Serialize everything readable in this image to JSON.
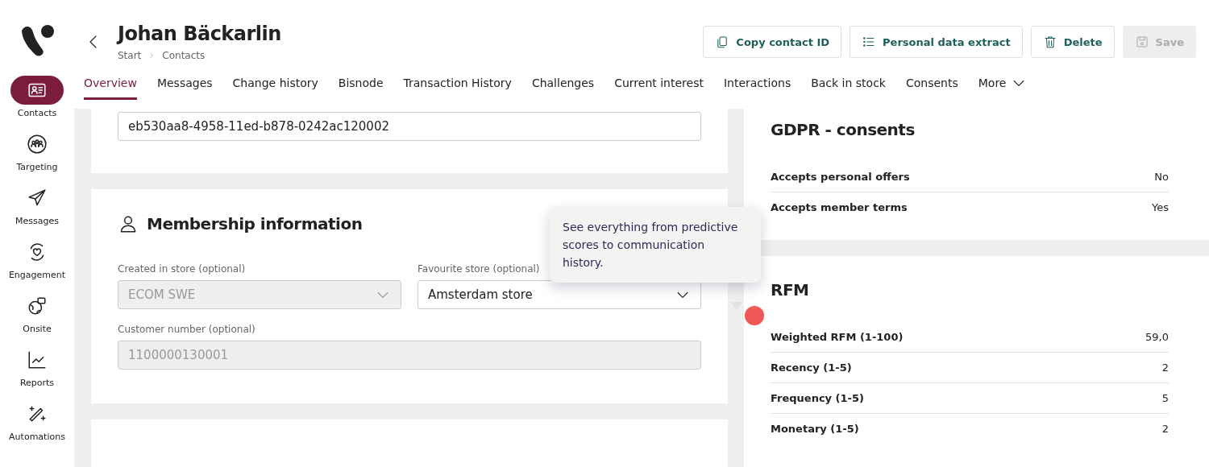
{
  "sidebar": {
    "items": [
      {
        "label": "Contacts",
        "selected": true
      },
      {
        "label": "Targeting",
        "selected": false
      },
      {
        "label": "Messages",
        "selected": false
      },
      {
        "label": "Engagement",
        "selected": false
      },
      {
        "label": "Onsite",
        "selected": false
      },
      {
        "label": "Reports",
        "selected": false
      },
      {
        "label": "Automations",
        "selected": false
      }
    ]
  },
  "header": {
    "title": "Johan Bäckarlin",
    "breadcrumb": [
      "Start",
      "Contacts"
    ],
    "buttons": [
      {
        "label": "Copy contact ID",
        "disabled": false
      },
      {
        "label": "Personal data extract",
        "disabled": false
      },
      {
        "label": "Delete",
        "disabled": false
      },
      {
        "label": "Save",
        "disabled": true
      }
    ]
  },
  "tabs": [
    {
      "label": "Overview",
      "selected": true,
      "kind": "tab"
    },
    {
      "label": "Messages",
      "selected": false,
      "kind": "tab"
    },
    {
      "label": "Change history",
      "selected": false,
      "kind": "tab"
    },
    {
      "label": "Bisnode",
      "selected": false,
      "kind": "tab"
    },
    {
      "label": "Transaction History",
      "selected": false,
      "kind": "tab"
    },
    {
      "label": "Challenges",
      "selected": false,
      "kind": "tab"
    },
    {
      "label": "Current interest",
      "selected": false,
      "kind": "tab"
    },
    {
      "label": "Interactions",
      "selected": false,
      "kind": "tab"
    },
    {
      "label": "Back in stock",
      "selected": false,
      "kind": "tab"
    },
    {
      "label": "Consents",
      "selected": false,
      "kind": "tab"
    },
    {
      "label": "More",
      "selected": false,
      "kind": "menu"
    }
  ],
  "id_field": {
    "value": "eb530aa8-4958-11ed-b878-0242ac120002"
  },
  "membership": {
    "title": "Membership information",
    "fields": [
      {
        "label": "Created in store (optional)",
        "value": "ECOM SWE",
        "disabled": true,
        "kind": "select"
      },
      {
        "label": "Favourite store (optional)",
        "value": "Amsterdam store",
        "disabled": false,
        "kind": "select"
      },
      {
        "label": "Customer number (optional)",
        "value": "1100000130001",
        "disabled": true,
        "kind": "text"
      }
    ]
  },
  "gdpr": {
    "title": "GDPR - consents",
    "rows": [
      {
        "label": "Accepts personal offers",
        "value": "No"
      },
      {
        "label": "Accepts member terms",
        "value": "Yes"
      }
    ]
  },
  "rfm": {
    "title": "RFM",
    "rows": [
      {
        "label": "Weighted RFM (1-100)",
        "value": "59,0"
      },
      {
        "label": "Recency (1-5)",
        "value": "2"
      },
      {
        "label": "Frequency (1-5)",
        "value": "5"
      },
      {
        "label": "Monetary (1-5)",
        "value": "2"
      }
    ]
  },
  "tooltip": {
    "text": "See everything from predictive scores to communication history."
  }
}
